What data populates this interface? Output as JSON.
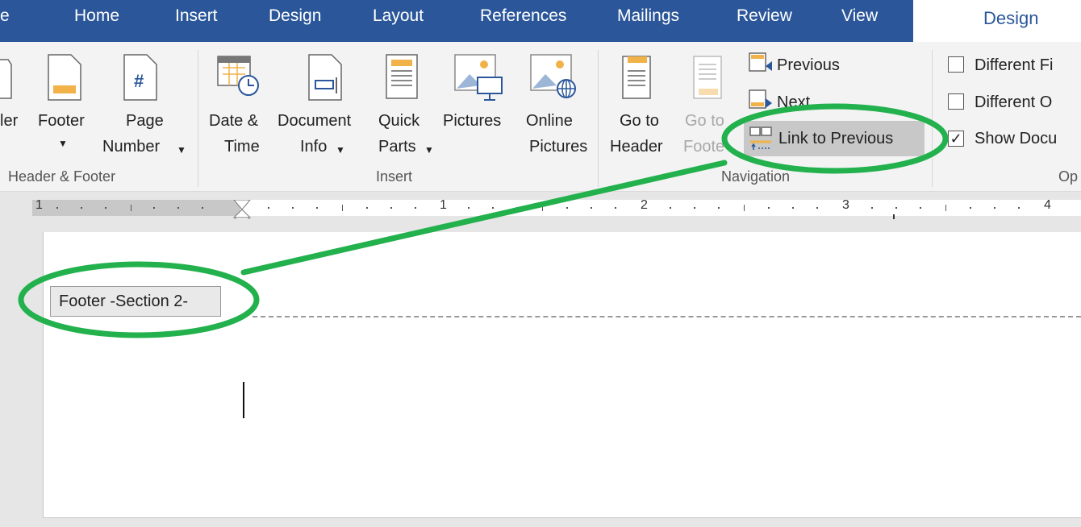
{
  "tabs": [
    "e",
    "Home",
    "Insert",
    "Design",
    "Layout",
    "References",
    "Mailings",
    "Review",
    "View"
  ],
  "contextual_tab": "Design",
  "ribbon": {
    "header_footer": {
      "header_partial": "ler",
      "footer": "Footer",
      "page_number": [
        "Page",
        "Number"
      ],
      "group_label": "Header & Footer"
    },
    "insert": {
      "date_time": [
        "Date &",
        "Time"
      ],
      "document_info": [
        "Document",
        "Info"
      ],
      "quick_parts": [
        "Quick",
        "Parts"
      ],
      "pictures": "Pictures",
      "online_pictures": [
        "Online",
        "Pictures"
      ],
      "group_label": "Insert"
    },
    "navigation": {
      "go_to_header": [
        "Go to",
        "Header"
      ],
      "go_to_footer": [
        "Go to",
        "Foote"
      ],
      "previous": "Previous",
      "next": "Next",
      "link_to_previous": "Link to Previous",
      "group_label": "Navigation"
    },
    "options": {
      "different_first": "Different Fi",
      "different_odd": "Different O",
      "show_document": "Show Docu",
      "group_label": "Op"
    }
  },
  "ruler": {
    "numbers": [
      "1",
      "1",
      "2",
      "3",
      "4"
    ]
  },
  "document": {
    "footer_label": "Footer -Section 2-"
  },
  "annotation": {
    "color": "#22b14c"
  },
  "colors": {
    "tab_bar": "#2b579a",
    "ribbon": "#f3f3f3"
  }
}
